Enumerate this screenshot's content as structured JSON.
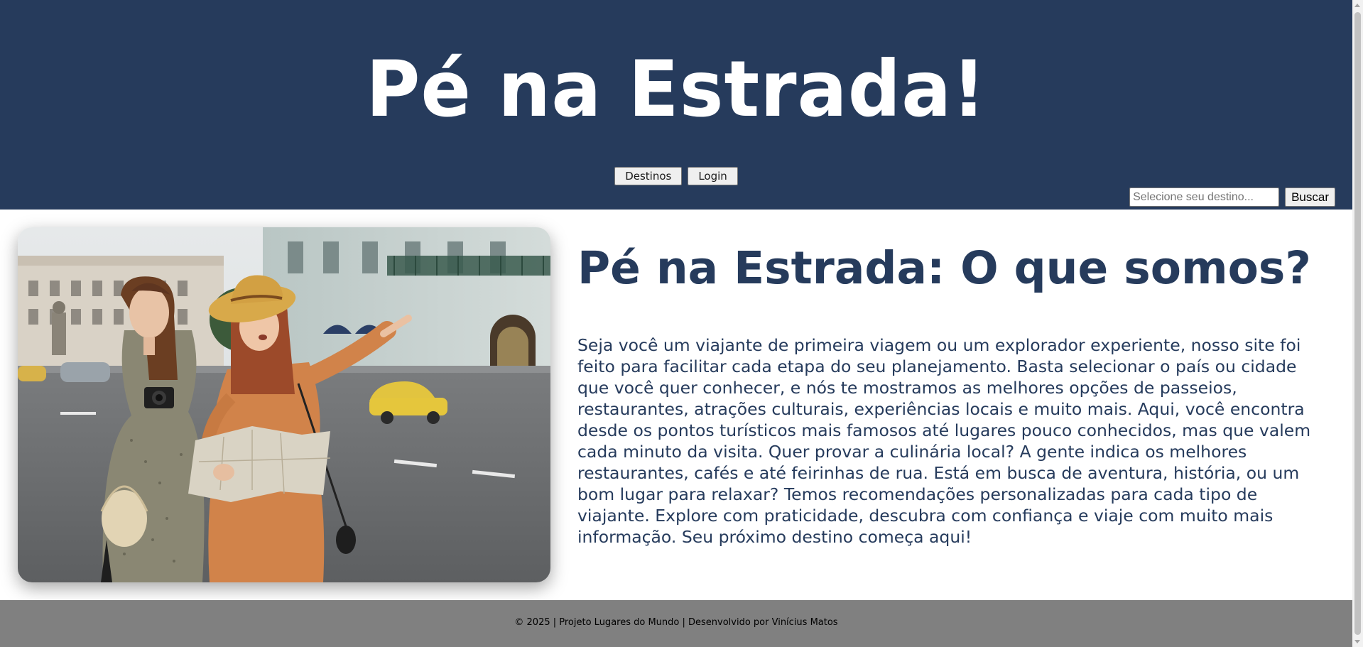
{
  "header": {
    "brand_title": "Pé na Estrada!",
    "nav": {
      "destinos_label": "Destinos",
      "login_label": "Login"
    },
    "search": {
      "placeholder": "Selecione seu destino...",
      "button_label": "Buscar"
    }
  },
  "main": {
    "image_alt": "Duas viajantes com mapa e câmera apontando na rua",
    "title": "Pé na Estrada: O que somos?",
    "text": "Seja você um viajante de primeira viagem ou um explorador experiente, nosso site foi feito para facilitar cada etapa do seu planejamento. Basta selecionar o país ou cidade que você quer conhecer, e nós te mostramos as melhores opções de passeios, restaurantes, atrações culturais, experiências locais e muito mais. Aqui, você encontra desde os pontos turísticos mais famosos até lugares pouco conhecidos, mas que valem cada minuto da visita. Quer provar a culinária local? A gente indica os melhores restaurantes, cafés e até feirinhas de rua. Está em busca de aventura, história, ou um bom lugar para relaxar? Temos recomendações personalizadas para cada tipo de viajante. Explore com praticidade, descubra com confiança e viaje com muito mais informação. Seu próximo destino começa aqui!"
  },
  "footer": {
    "text": "© 2025 | Projeto Lugares do Mundo | Desenvolvido por Vinícius Matos"
  },
  "colors": {
    "header_bg": "#263b5c",
    "title_text": "#263b5c",
    "footer_bg": "#808080"
  }
}
